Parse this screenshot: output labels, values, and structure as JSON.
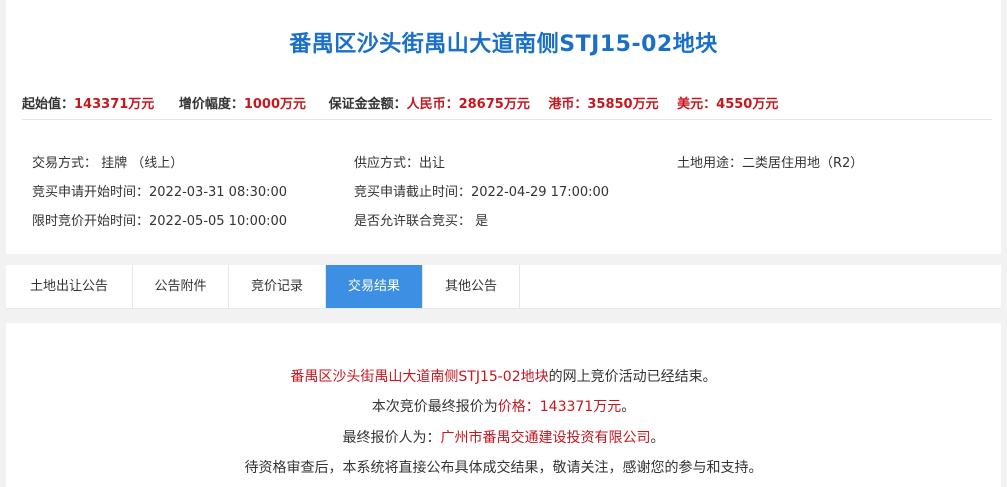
{
  "title": "番禺区沙头街禺山大道南侧STJ15-02地块",
  "price": {
    "start_label": "起始值：",
    "start_value": "143371万元",
    "increment_label": "增价幅度：",
    "increment_value": "1000万元",
    "deposit_label": "保证金金额：",
    "rmb_label": "人民币：",
    "rmb_value": "28675万元",
    "hkd_label": "港币：",
    "hkd_value": "35850万元",
    "usd_label": "美元：",
    "usd_value": "4550万元"
  },
  "info": {
    "trade_mode": "交易方式： 挂牌 （线上）",
    "supply_mode": "供应方式：出让",
    "land_use": "土地用途：二类居住用地（R2）",
    "apply_start": "竞买申请开始时间：2022-03-31 08:30:00",
    "apply_end": "竞买申请截止时间：2022-04-29 17:00:00",
    "bid_start": "限时竞价开始时间：2022-05-05 10:00:00",
    "joint_bid": "是否允许联合竞买： 是"
  },
  "tabs": [
    {
      "label": "土地出让公告"
    },
    {
      "label": "公告附件"
    },
    {
      "label": "竞价记录"
    },
    {
      "label": "交易结果"
    },
    {
      "label": "其他公告"
    }
  ],
  "result": {
    "line1_parcel": "番禺区沙头街禺山大道南侧STJ15-02地块",
    "line1_rest": "的网上竞价活动已经结束。",
    "line2_prefix": "本次竞价最终报价为",
    "line2_price": "价格：143371万元",
    "line2_suffix": "。",
    "line3_prefix": "最终报价人为：",
    "line3_bidder": "广州市番禺交通建设投资有限公司",
    "line3_suffix": "。",
    "line4": "待资格审查后，本系统将直接公布具体成交结果，敬请关注，感谢您的参与和支持。"
  },
  "colors": {
    "title": "#1a6fc9",
    "highlight": "#c8161d",
    "active_tab": "#3d8fe3"
  }
}
